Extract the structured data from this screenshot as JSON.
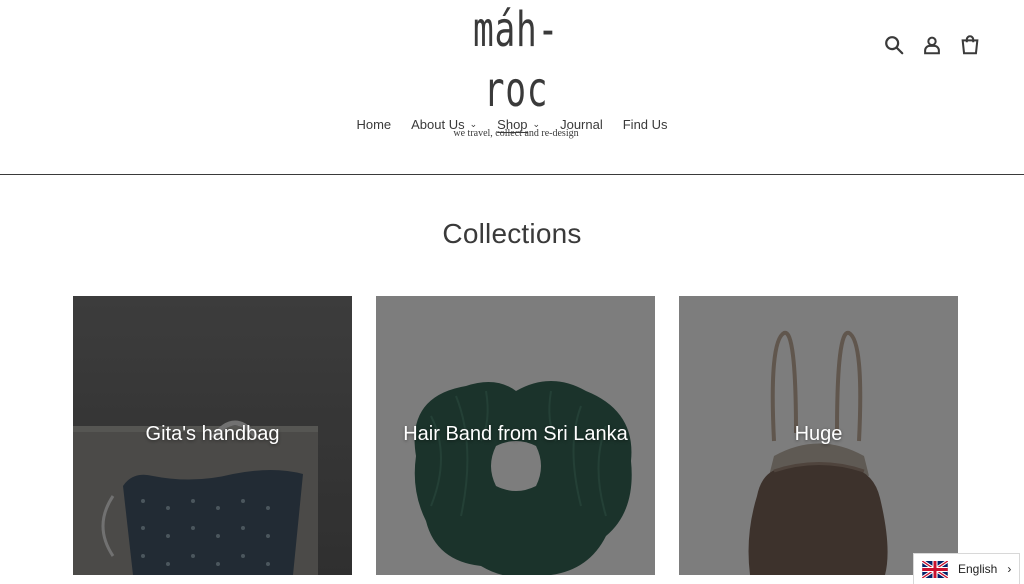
{
  "brand": {
    "logo_text": "máh-roc",
    "tagline": "we travel, collect and re-design"
  },
  "header_icons": [
    "search-icon",
    "account-icon",
    "cart-icon"
  ],
  "nav": {
    "items": [
      {
        "label": "Home",
        "has_dropdown": false
      },
      {
        "label": "About Us",
        "has_dropdown": true
      },
      {
        "label": "Shop",
        "has_dropdown": true,
        "active": true
      },
      {
        "label": "Journal",
        "has_dropdown": false
      },
      {
        "label": "Find Us",
        "has_dropdown": false
      }
    ]
  },
  "page": {
    "title": "Collections"
  },
  "collections": [
    {
      "title": "Gita's handbag"
    },
    {
      "title": "Hair Band from Sri Lanka"
    },
    {
      "title": "Huge"
    }
  ],
  "language": {
    "current": "English"
  },
  "colors": {
    "text": "#3a3a3a",
    "overlay": "#00000055"
  }
}
